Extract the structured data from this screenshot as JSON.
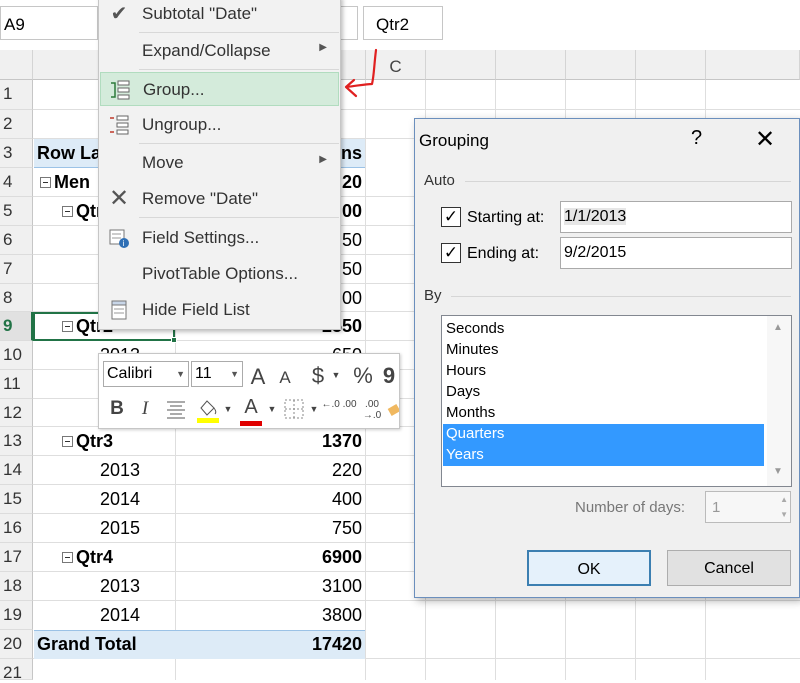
{
  "formula_bar": {
    "name_box": "A9",
    "right_box": "Qtr2"
  },
  "columns": {
    "c": "C"
  },
  "rows": [
    "1",
    "2",
    "3",
    "4",
    "5",
    "6",
    "7",
    "8",
    "9",
    "10",
    "11",
    "12",
    "13",
    "14",
    "15",
    "16",
    "17",
    "18",
    "19",
    "20",
    "21"
  ],
  "pivot": {
    "row_labels_header": "Row La",
    "values_header": "ns",
    "r4": {
      "label": "Men",
      "value": "20"
    },
    "r5": {
      "label": "Qtr",
      "value": "00"
    },
    "r6": {
      "value": "50"
    },
    "r7": {
      "value": "50"
    },
    "r8": {
      "value": "00"
    },
    "r9": {
      "label": "Qtr2",
      "value": "2550"
    },
    "r10": {
      "label": "2013",
      "value": "650"
    },
    "qtr3": {
      "label": "Qtr3",
      "value": "1370"
    },
    "r14": {
      "label": "2013",
      "value": "220"
    },
    "r15": {
      "label": "2014",
      "value": "400"
    },
    "r16": {
      "label": "2015",
      "value": "750"
    },
    "qtr4": {
      "label": "Qtr4",
      "value": "6900"
    },
    "r18": {
      "label": "2013",
      "value": "3100"
    },
    "r19": {
      "label": "2014",
      "value": "3800"
    },
    "grand_total": {
      "label": "Grand Total",
      "value": "17420"
    }
  },
  "context_menu": {
    "subtotal": "Subtotal \"Date\"",
    "expand": "Expand/Collapse",
    "group": "Group...",
    "ungroup": "Ungroup...",
    "move": "Move",
    "remove": "Remove \"Date\"",
    "field_settings": "Field Settings...",
    "pivot_options": "PivotTable Options...",
    "hide_field_list": "Hide Field List"
  },
  "mini_toolbar": {
    "font": "Calibri",
    "size": "11",
    "grow": "A",
    "shrink": "A",
    "currency": "$",
    "percent": "%",
    "comma": "9",
    "bold": "B",
    "italic": "I",
    "font_color": "A",
    "inc_decimal": "←.0 .00",
    "dec_decimal": ".00 →.0"
  },
  "dialog": {
    "title": "Grouping",
    "help": "?",
    "close": "✕",
    "auto_label": "Auto",
    "starting_label": "Starting at:",
    "starting_value": "1/1/2013",
    "ending_label": "Ending at:",
    "ending_value": "9/2/2015",
    "by_label": "By",
    "by_items": [
      "Seconds",
      "Minutes",
      "Hours",
      "Days",
      "Months",
      "Quarters",
      "Years"
    ],
    "by_selected": [
      5,
      6
    ],
    "num_days_label": "Number of days:",
    "num_days_value": "1",
    "ok": "OK",
    "cancel": "Cancel"
  },
  "colors": {
    "selection_green": "#217346",
    "menu_highlight": "#d4ebdb",
    "list_selection": "#3399ff",
    "pivot_band": "#ddebf7",
    "annotation_red": "#e02020"
  }
}
